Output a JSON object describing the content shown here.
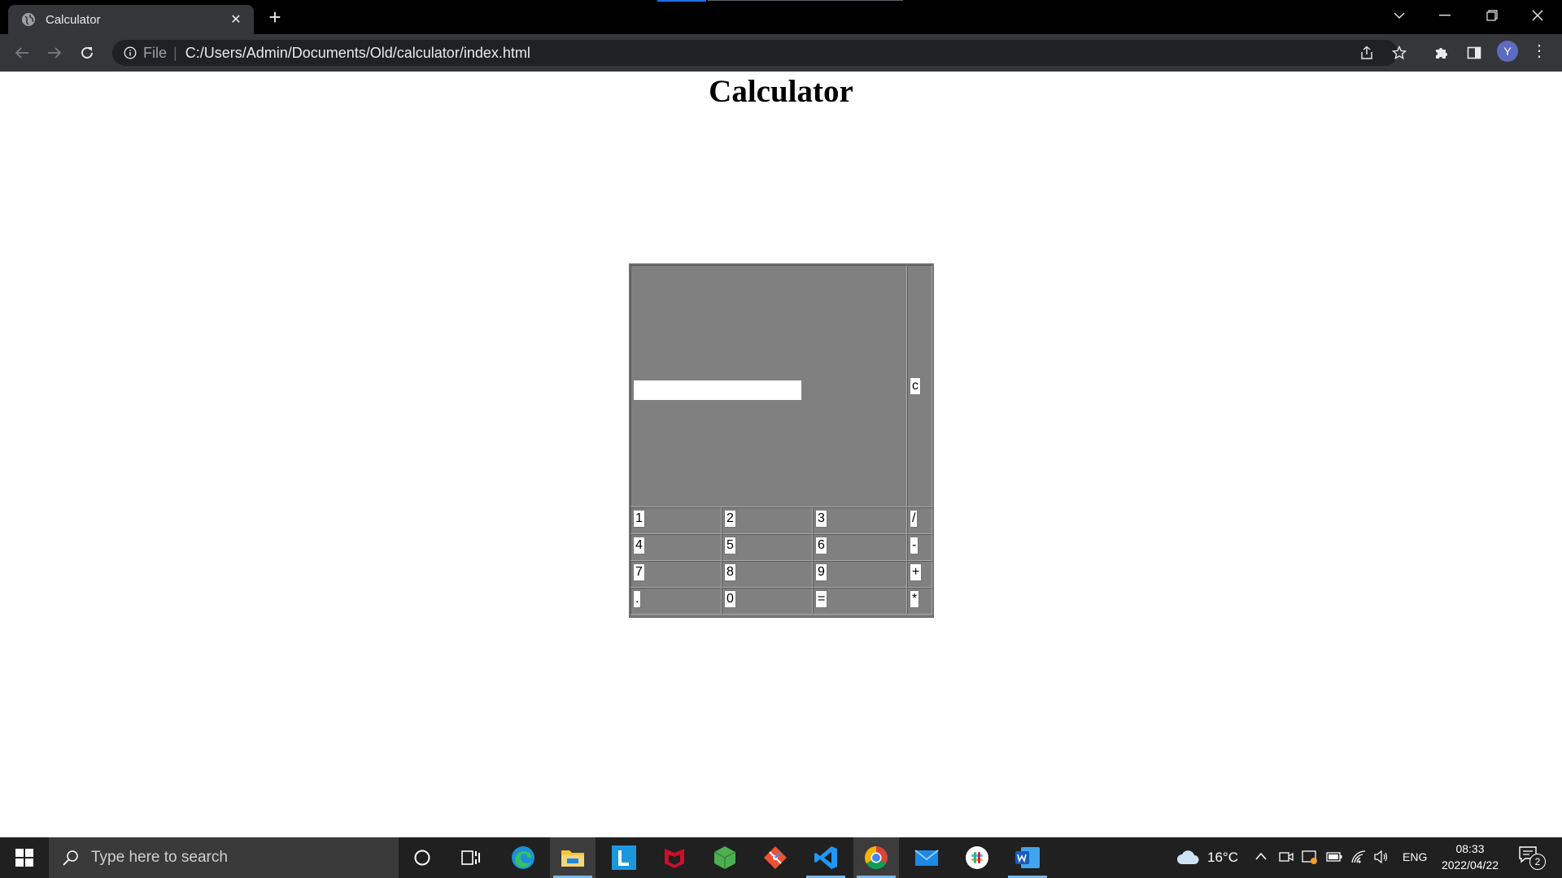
{
  "browser": {
    "tab_title": "Calculator",
    "address_prefix": "File",
    "url": "C:/Users/Admin/Documents/Old/calculator/index.html",
    "profile_initial": "Y"
  },
  "page": {
    "title": "Calculator",
    "display_value": "",
    "clear_label": "c",
    "rows": [
      [
        "1",
        "2",
        "3",
        "/"
      ],
      [
        "4",
        "5",
        "6",
        "-"
      ],
      [
        "7",
        "8",
        "9",
        "+"
      ],
      [
        ".",
        "0",
        "=",
        "*"
      ]
    ]
  },
  "taskbar": {
    "search_placeholder": "Type here to search",
    "weather": "16°C",
    "language": "ENG",
    "time": "08:33",
    "date": "2022/04/22",
    "notification_count": "2",
    "apps": [
      "cortana-icon",
      "task-view-icon",
      "edge-icon",
      "file-explorer-icon",
      "lucid-icon",
      "mcafee-icon",
      "cube-app-icon",
      "git-icon",
      "vscode-icon",
      "chrome-icon",
      "mail-icon",
      "slack-icon",
      "word-icon"
    ]
  },
  "colors": {
    "calculator_bg": "#808080",
    "chrome_dark": "#35363a",
    "taskbar_bg": "#202020",
    "active_indicator": "#76b9ed"
  }
}
